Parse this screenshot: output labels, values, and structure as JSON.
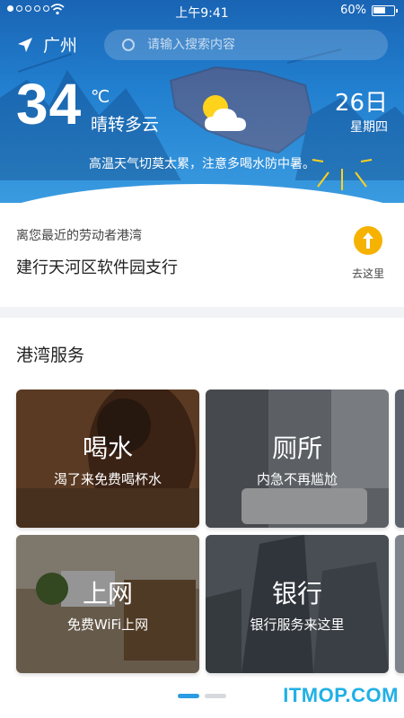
{
  "status_bar": {
    "time": "上午9:41",
    "battery_percent_text": "60%",
    "battery_level": 0.6
  },
  "header": {
    "city": "广州",
    "search_placeholder": "请输入搜索内容",
    "temperature": "34",
    "unit": "℃",
    "condition": "晴转多云",
    "date": "26日",
    "weekday": "星期四",
    "tip": "高温天气切莫太累，注意多喝水防中暑。",
    "icons": {
      "location": "location-arrow-icon",
      "search": "search-icon",
      "weather": "sun-cloud-icon"
    }
  },
  "nearest": {
    "caption": "离您最近的劳动者港湾",
    "name": "建行天河区软件园支行",
    "action_label": "去这里",
    "action_icon": "navigate-arrow-icon",
    "action_color": "#f6b200"
  },
  "services": {
    "title": "港湾服务",
    "cards": [
      {
        "title": "喝水",
        "subtitle": "渴了来免费喝杯水"
      },
      {
        "title": "厕所",
        "subtitle": "内急不再尴尬"
      },
      {
        "title": "上网",
        "subtitle": "免费WiFi上网"
      },
      {
        "title": "银行",
        "subtitle": "银行服务来这里"
      }
    ]
  },
  "pager": {
    "active_color": "#2b9be3",
    "inactive_color": "#d6d9de",
    "pages": 2,
    "active_index": 0
  },
  "watermark": "ITMOP.COM"
}
